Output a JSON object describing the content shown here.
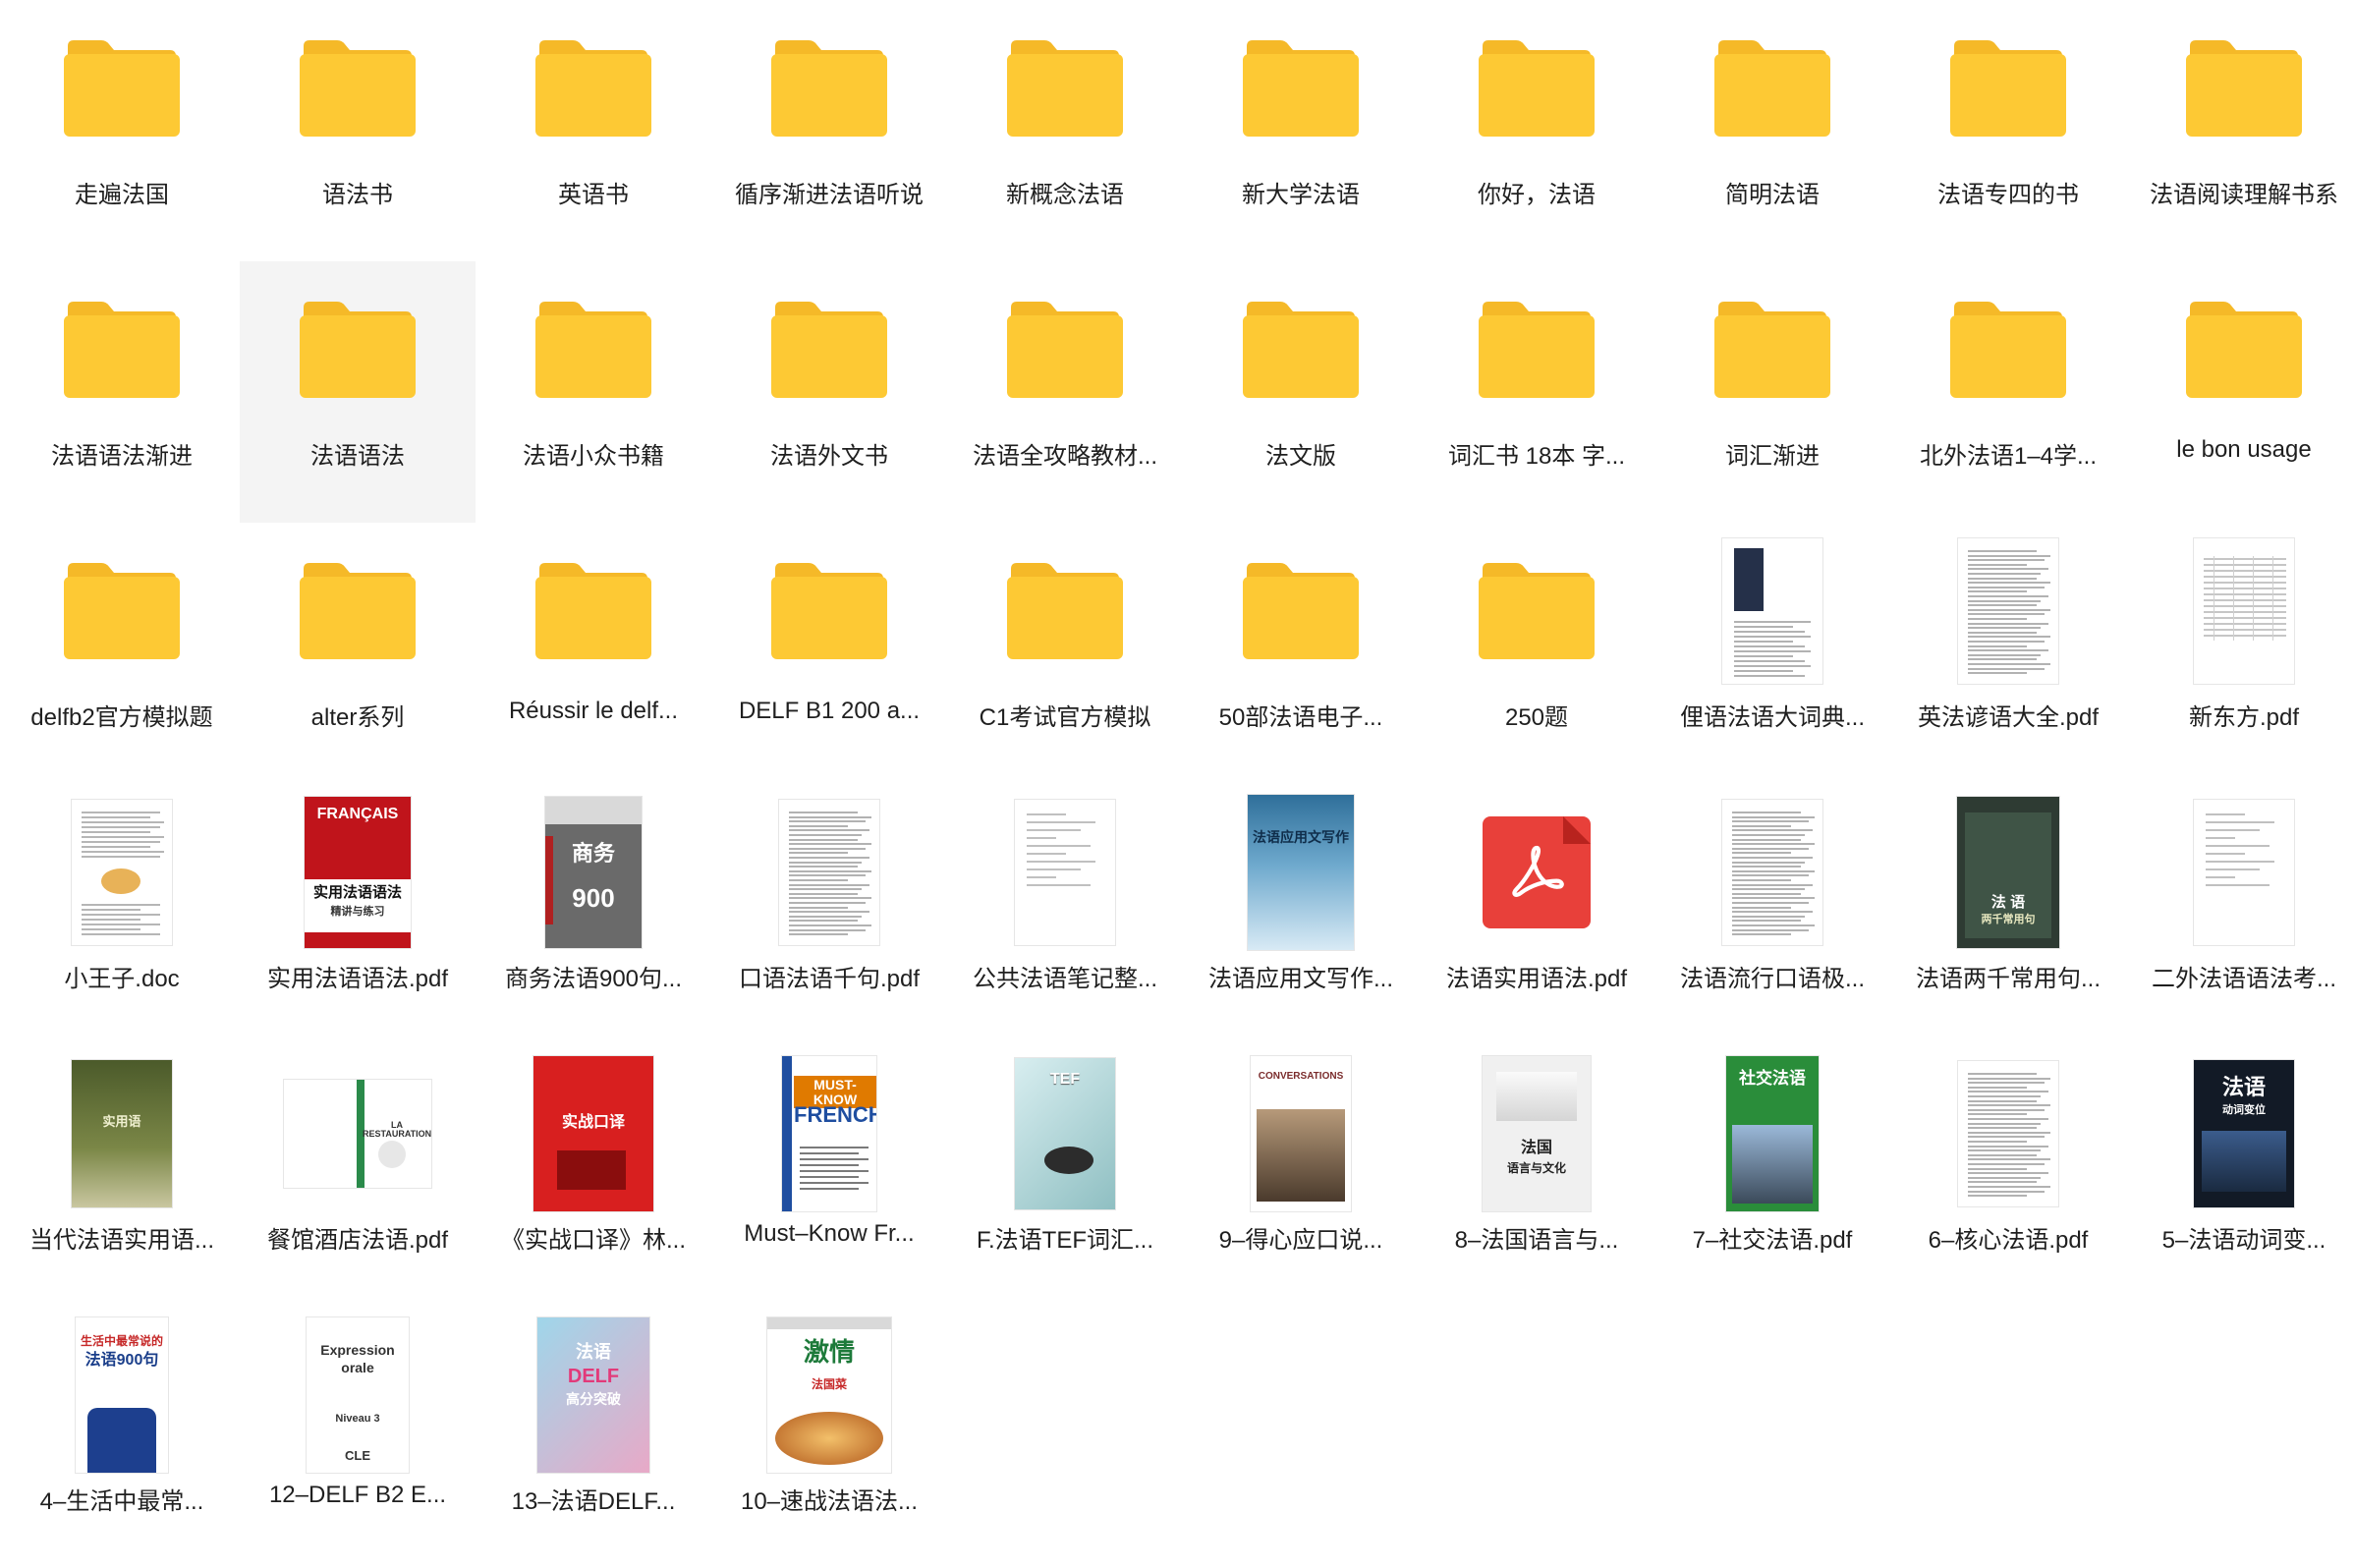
{
  "colors": {
    "folder_body": "#fdc934",
    "folder_tab": "#f5b928",
    "selection": "#f4f4f4"
  },
  "rows": [
    {
      "items": [
        {
          "type": "folder",
          "name": "走遍法国"
        },
        {
          "type": "folder",
          "name": "语法书"
        },
        {
          "type": "folder",
          "name": "英语书"
        },
        {
          "type": "folder",
          "name": "循序渐进法语听说"
        },
        {
          "type": "folder",
          "name": "新概念法语"
        },
        {
          "type": "folder",
          "name": "新大学法语"
        },
        {
          "type": "folder",
          "name": "你好，法语"
        },
        {
          "type": "folder",
          "name": "简明法语"
        },
        {
          "type": "folder",
          "name": "法语专四的书"
        },
        {
          "type": "folder",
          "name": "法语阅读理解书系"
        }
      ]
    },
    {
      "items": [
        {
          "type": "folder",
          "name": "法语语法渐进"
        },
        {
          "type": "folder",
          "name": "法语语法",
          "selected": true
        },
        {
          "type": "folder",
          "name": "法语小众书籍"
        },
        {
          "type": "folder",
          "name": "法语外文书"
        },
        {
          "type": "folder",
          "name": "法语全攻略教材..."
        },
        {
          "type": "folder",
          "name": "法文版"
        },
        {
          "type": "folder",
          "name": "词汇书 18本 字..."
        },
        {
          "type": "folder",
          "name": "词汇渐进"
        },
        {
          "type": "folder",
          "name": "北外法语1–4学..."
        },
        {
          "type": "folder",
          "name": "le bon usage"
        }
      ]
    },
    {
      "items": [
        {
          "type": "folder",
          "name": "delfb2官方模拟题"
        },
        {
          "type": "folder",
          "name": "alter系列"
        },
        {
          "type": "folder",
          "name": "Réussir le delf..."
        },
        {
          "type": "folder",
          "name": "DELF B1 200 a..."
        },
        {
          "type": "folder",
          "name": "C1考试官方模拟"
        },
        {
          "type": "folder",
          "name": "50部法语电子..."
        },
        {
          "type": "folder",
          "name": "250题"
        },
        {
          "type": "file",
          "name": "俚语法语大词典...",
          "thumb": "doc-dark-block"
        },
        {
          "type": "file",
          "name": "英法谚语大全.pdf",
          "thumb": "doc-text"
        },
        {
          "type": "file",
          "name": "新东方.pdf",
          "thumb": "doc-table"
        }
      ]
    },
    {
      "items": [
        {
          "type": "file",
          "name": "小王子.doc",
          "thumb": "doc-image"
        },
        {
          "type": "file",
          "name": "实用法语语法.pdf",
          "thumb": "cover-francais",
          "cover_title": "FRANÇAIS",
          "cover_subtitle": "实用法语语法",
          "cover_line": "精讲与练习"
        },
        {
          "type": "file",
          "name": "商务法语900句...",
          "thumb": "cover-900",
          "cover_title": "商务",
          "cover_number": "900"
        },
        {
          "type": "file",
          "name": "口语法语千句.pdf",
          "thumb": "doc-text"
        },
        {
          "type": "file",
          "name": "公共法语笔记整...",
          "thumb": "doc-sparse"
        },
        {
          "type": "file",
          "name": "法语应用文写作...",
          "thumb": "cover-blue",
          "cover_title": "法语应用文写作"
        },
        {
          "type": "file",
          "name": "法语实用语法.pdf",
          "thumb": "pdf-app"
        },
        {
          "type": "file",
          "name": "法语流行口语极...",
          "thumb": "doc-text"
        },
        {
          "type": "file",
          "name": "法语两千常用句...",
          "thumb": "cover-green",
          "cover_title": "法 语",
          "cover_subtitle": "两千常用句"
        },
        {
          "type": "file",
          "name": "二外法语语法考...",
          "thumb": "doc-sparse"
        }
      ]
    },
    {
      "items": [
        {
          "type": "file",
          "name": "当代法语实用语...",
          "thumb": "cover-olive",
          "cover_title": "实用语"
        },
        {
          "type": "file",
          "name": "餐馆酒店法语.pdf",
          "thumb": "cover-restaurant",
          "cover_title": "LA RESTAURATION"
        },
        {
          "type": "file",
          "name": "《实战口译》林...",
          "thumb": "cover-red",
          "cover_title": "实战口译"
        },
        {
          "type": "file",
          "name": "Must–Know Fr...",
          "thumb": "cover-mustknow",
          "cover_title": "MUST-KNOW",
          "cover_subtitle": "FRENCH"
        },
        {
          "type": "file",
          "name": "F.法语TEF词汇...",
          "thumb": "cover-tef",
          "cover_title": "TEF"
        },
        {
          "type": "file",
          "name": "9–得心应口说...",
          "thumb": "cover-conversations",
          "cover_title": "CONVERSATIONS"
        },
        {
          "type": "file",
          "name": "8–法国语言与...",
          "thumb": "cover-langue",
          "cover_title": "法国",
          "cover_subtitle": "语言与文化"
        },
        {
          "type": "file",
          "name": "7–社交法语.pdf",
          "thumb": "cover-social",
          "cover_title": "社交法语"
        },
        {
          "type": "file",
          "name": "6–核心法语.pdf",
          "thumb": "doc-text"
        },
        {
          "type": "file",
          "name": "5–法语动词变...",
          "thumb": "cover-verbs",
          "cover_title": "法语",
          "cover_subtitle": "动词变位"
        }
      ]
    },
    {
      "items": [
        {
          "type": "file",
          "name": "4–生活中最常...",
          "thumb": "cover-900b",
          "cover_title": "生活中最常说的",
          "cover_subtitle": "法语900句"
        },
        {
          "type": "file",
          "name": "12–DELF B2 E...",
          "thumb": "cover-expression",
          "cover_title": "Expression",
          "cover_subtitle": "orale",
          "cover_line": "Niveau 3",
          "cover_brand": "CLE"
        },
        {
          "type": "file",
          "name": "13–法语DELF...",
          "thumb": "cover-delf",
          "cover_title": "法语",
          "cover_subtitle": "DELF",
          "cover_line": "高分突破"
        },
        {
          "type": "file",
          "name": "10–速战法语法...",
          "thumb": "cover-food",
          "cover_title": "激情",
          "cover_subtitle": "法国菜"
        }
      ]
    }
  ]
}
